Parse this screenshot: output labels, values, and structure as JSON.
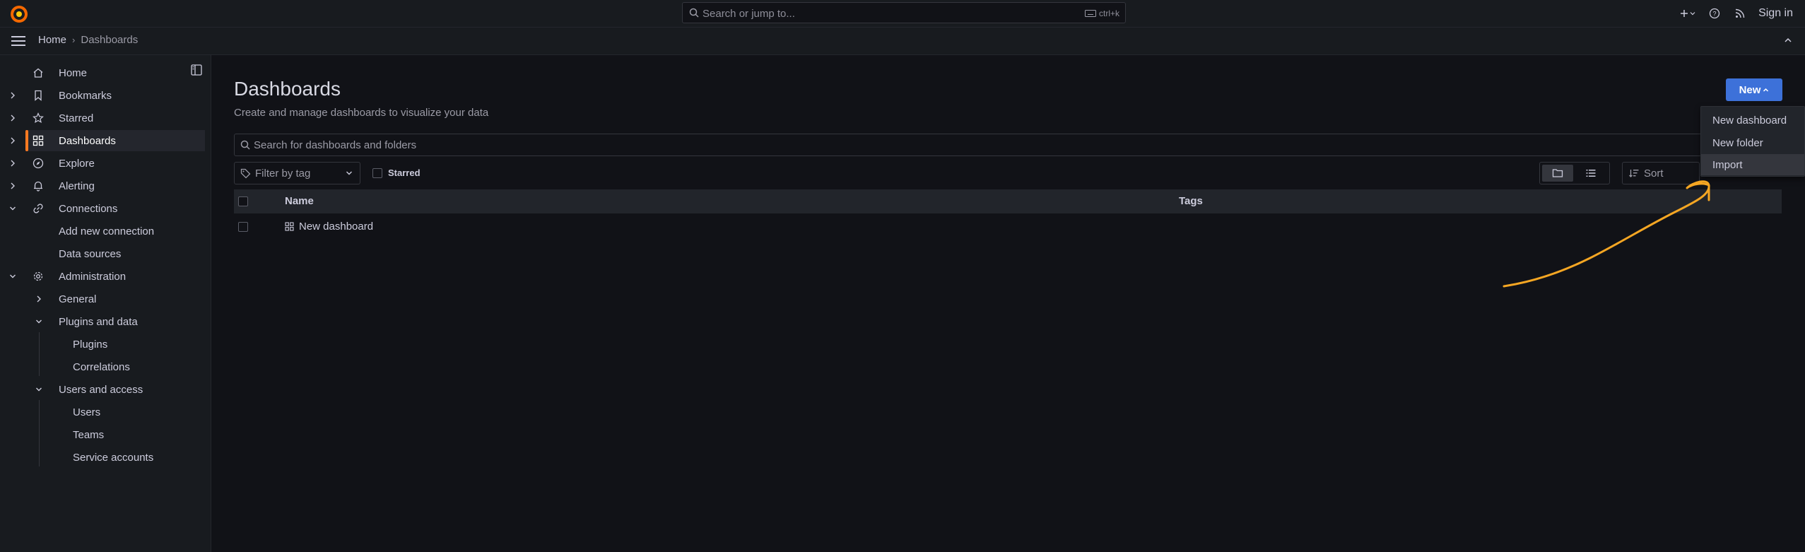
{
  "topbar": {
    "search_placeholder": "Search or jump to...",
    "shortcut": "ctrl+k",
    "sign_in": "Sign in"
  },
  "breadcrumb": {
    "home": "Home",
    "separator": "›",
    "current": "Dashboards"
  },
  "sidebar": {
    "items": [
      {
        "label": "Home",
        "icon": "home-icon"
      },
      {
        "label": "Bookmarks",
        "icon": "bookmark-icon"
      },
      {
        "label": "Starred",
        "icon": "star-icon"
      },
      {
        "label": "Dashboards",
        "icon": "apps-icon",
        "active": true
      },
      {
        "label": "Explore",
        "icon": "compass-icon"
      },
      {
        "label": "Alerting",
        "icon": "bell-icon"
      },
      {
        "label": "Connections",
        "icon": "link-icon"
      },
      {
        "label": "Add new connection"
      },
      {
        "label": "Data sources"
      },
      {
        "label": "Administration",
        "icon": "cog-icon"
      },
      {
        "label": "General"
      },
      {
        "label": "Plugins and data"
      },
      {
        "label": "Plugins"
      },
      {
        "label": "Correlations"
      },
      {
        "label": "Users and access"
      },
      {
        "label": "Users"
      },
      {
        "label": "Teams"
      },
      {
        "label": "Service accounts"
      }
    ]
  },
  "main": {
    "title": "Dashboards",
    "subtitle": "Create and manage dashboards to visualize your data",
    "new_button": "New",
    "search_placeholder": "Search for dashboards and folders",
    "filter_tag_placeholder": "Filter by tag",
    "starred_label": "Starred",
    "sort_placeholder": "Sort",
    "table": {
      "columns": [
        "Name",
        "Tags"
      ],
      "rows": [
        {
          "name": "New dashboard"
        }
      ]
    }
  },
  "new_menu": {
    "items": [
      "New dashboard",
      "New folder",
      "Import"
    ],
    "highlighted": "Import"
  },
  "colors": {
    "accent": "#ff7a21",
    "primary_button": "#3d71d9",
    "annotation": "#f5a623"
  }
}
